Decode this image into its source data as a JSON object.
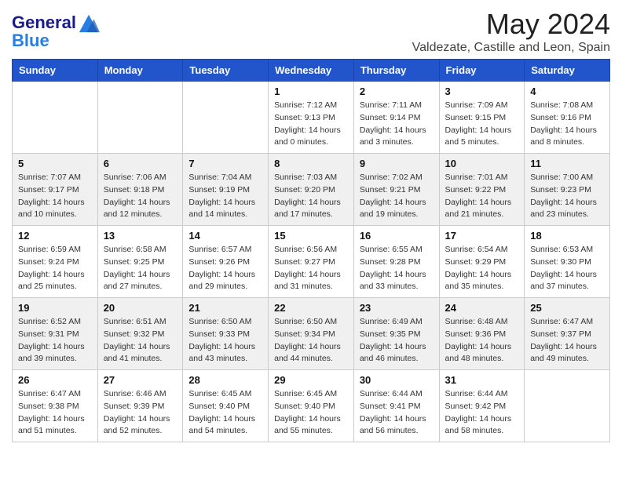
{
  "logo": {
    "text_general": "General",
    "text_blue": "Blue"
  },
  "header": {
    "month": "May 2024",
    "location": "Valdezate, Castille and Leon, Spain"
  },
  "weekdays": [
    "Sunday",
    "Monday",
    "Tuesday",
    "Wednesday",
    "Thursday",
    "Friday",
    "Saturday"
  ],
  "weeks": [
    [
      {
        "day": "",
        "sunrise": "",
        "sunset": "",
        "daylight": ""
      },
      {
        "day": "",
        "sunrise": "",
        "sunset": "",
        "daylight": ""
      },
      {
        "day": "",
        "sunrise": "",
        "sunset": "",
        "daylight": ""
      },
      {
        "day": "1",
        "sunrise": "Sunrise: 7:12 AM",
        "sunset": "Sunset: 9:13 PM",
        "daylight": "Daylight: 14 hours and 0 minutes."
      },
      {
        "day": "2",
        "sunrise": "Sunrise: 7:11 AM",
        "sunset": "Sunset: 9:14 PM",
        "daylight": "Daylight: 14 hours and 3 minutes."
      },
      {
        "day": "3",
        "sunrise": "Sunrise: 7:09 AM",
        "sunset": "Sunset: 9:15 PM",
        "daylight": "Daylight: 14 hours and 5 minutes."
      },
      {
        "day": "4",
        "sunrise": "Sunrise: 7:08 AM",
        "sunset": "Sunset: 9:16 PM",
        "daylight": "Daylight: 14 hours and 8 minutes."
      }
    ],
    [
      {
        "day": "5",
        "sunrise": "Sunrise: 7:07 AM",
        "sunset": "Sunset: 9:17 PM",
        "daylight": "Daylight: 14 hours and 10 minutes."
      },
      {
        "day": "6",
        "sunrise": "Sunrise: 7:06 AM",
        "sunset": "Sunset: 9:18 PM",
        "daylight": "Daylight: 14 hours and 12 minutes."
      },
      {
        "day": "7",
        "sunrise": "Sunrise: 7:04 AM",
        "sunset": "Sunset: 9:19 PM",
        "daylight": "Daylight: 14 hours and 14 minutes."
      },
      {
        "day": "8",
        "sunrise": "Sunrise: 7:03 AM",
        "sunset": "Sunset: 9:20 PM",
        "daylight": "Daylight: 14 hours and 17 minutes."
      },
      {
        "day": "9",
        "sunrise": "Sunrise: 7:02 AM",
        "sunset": "Sunset: 9:21 PM",
        "daylight": "Daylight: 14 hours and 19 minutes."
      },
      {
        "day": "10",
        "sunrise": "Sunrise: 7:01 AM",
        "sunset": "Sunset: 9:22 PM",
        "daylight": "Daylight: 14 hours and 21 minutes."
      },
      {
        "day": "11",
        "sunrise": "Sunrise: 7:00 AM",
        "sunset": "Sunset: 9:23 PM",
        "daylight": "Daylight: 14 hours and 23 minutes."
      }
    ],
    [
      {
        "day": "12",
        "sunrise": "Sunrise: 6:59 AM",
        "sunset": "Sunset: 9:24 PM",
        "daylight": "Daylight: 14 hours and 25 minutes."
      },
      {
        "day": "13",
        "sunrise": "Sunrise: 6:58 AM",
        "sunset": "Sunset: 9:25 PM",
        "daylight": "Daylight: 14 hours and 27 minutes."
      },
      {
        "day": "14",
        "sunrise": "Sunrise: 6:57 AM",
        "sunset": "Sunset: 9:26 PM",
        "daylight": "Daylight: 14 hours and 29 minutes."
      },
      {
        "day": "15",
        "sunrise": "Sunrise: 6:56 AM",
        "sunset": "Sunset: 9:27 PM",
        "daylight": "Daylight: 14 hours and 31 minutes."
      },
      {
        "day": "16",
        "sunrise": "Sunrise: 6:55 AM",
        "sunset": "Sunset: 9:28 PM",
        "daylight": "Daylight: 14 hours and 33 minutes."
      },
      {
        "day": "17",
        "sunrise": "Sunrise: 6:54 AM",
        "sunset": "Sunset: 9:29 PM",
        "daylight": "Daylight: 14 hours and 35 minutes."
      },
      {
        "day": "18",
        "sunrise": "Sunrise: 6:53 AM",
        "sunset": "Sunset: 9:30 PM",
        "daylight": "Daylight: 14 hours and 37 minutes."
      }
    ],
    [
      {
        "day": "19",
        "sunrise": "Sunrise: 6:52 AM",
        "sunset": "Sunset: 9:31 PM",
        "daylight": "Daylight: 14 hours and 39 minutes."
      },
      {
        "day": "20",
        "sunrise": "Sunrise: 6:51 AM",
        "sunset": "Sunset: 9:32 PM",
        "daylight": "Daylight: 14 hours and 41 minutes."
      },
      {
        "day": "21",
        "sunrise": "Sunrise: 6:50 AM",
        "sunset": "Sunset: 9:33 PM",
        "daylight": "Daylight: 14 hours and 43 minutes."
      },
      {
        "day": "22",
        "sunrise": "Sunrise: 6:50 AM",
        "sunset": "Sunset: 9:34 PM",
        "daylight": "Daylight: 14 hours and 44 minutes."
      },
      {
        "day": "23",
        "sunrise": "Sunrise: 6:49 AM",
        "sunset": "Sunset: 9:35 PM",
        "daylight": "Daylight: 14 hours and 46 minutes."
      },
      {
        "day": "24",
        "sunrise": "Sunrise: 6:48 AM",
        "sunset": "Sunset: 9:36 PM",
        "daylight": "Daylight: 14 hours and 48 minutes."
      },
      {
        "day": "25",
        "sunrise": "Sunrise: 6:47 AM",
        "sunset": "Sunset: 9:37 PM",
        "daylight": "Daylight: 14 hours and 49 minutes."
      }
    ],
    [
      {
        "day": "26",
        "sunrise": "Sunrise: 6:47 AM",
        "sunset": "Sunset: 9:38 PM",
        "daylight": "Daylight: 14 hours and 51 minutes."
      },
      {
        "day": "27",
        "sunrise": "Sunrise: 6:46 AM",
        "sunset": "Sunset: 9:39 PM",
        "daylight": "Daylight: 14 hours and 52 minutes."
      },
      {
        "day": "28",
        "sunrise": "Sunrise: 6:45 AM",
        "sunset": "Sunset: 9:40 PM",
        "daylight": "Daylight: 14 hours and 54 minutes."
      },
      {
        "day": "29",
        "sunrise": "Sunrise: 6:45 AM",
        "sunset": "Sunset: 9:40 PM",
        "daylight": "Daylight: 14 hours and 55 minutes."
      },
      {
        "day": "30",
        "sunrise": "Sunrise: 6:44 AM",
        "sunset": "Sunset: 9:41 PM",
        "daylight": "Daylight: 14 hours and 56 minutes."
      },
      {
        "day": "31",
        "sunrise": "Sunrise: 6:44 AM",
        "sunset": "Sunset: 9:42 PM",
        "daylight": "Daylight: 14 hours and 58 minutes."
      },
      {
        "day": "",
        "sunrise": "",
        "sunset": "",
        "daylight": ""
      }
    ]
  ]
}
